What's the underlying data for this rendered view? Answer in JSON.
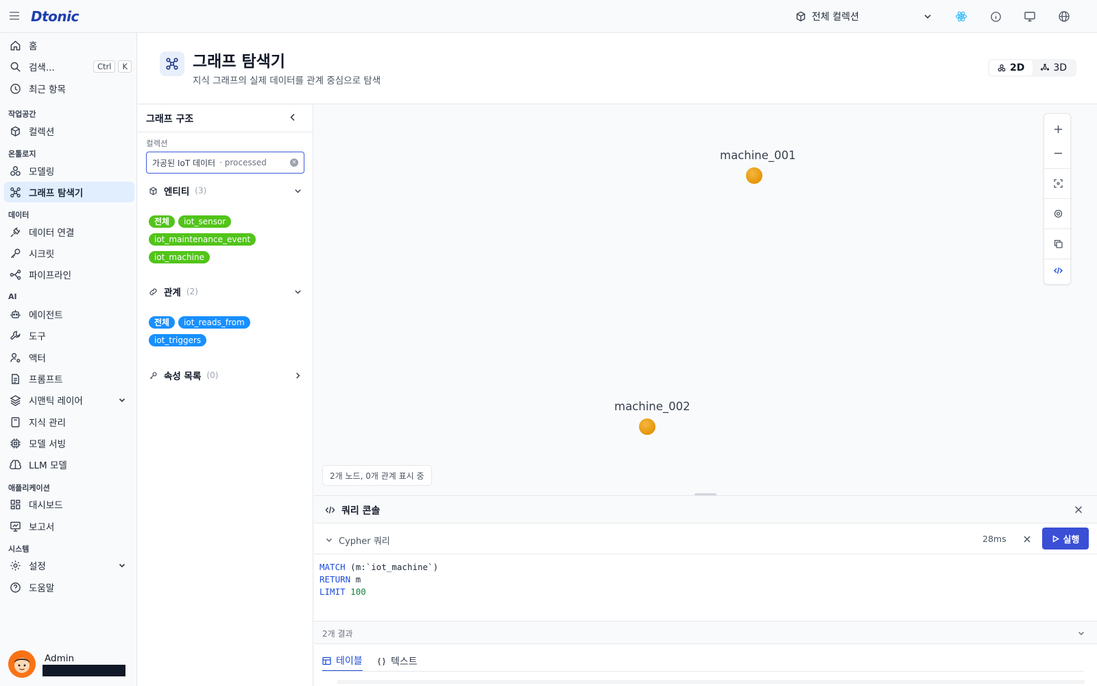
{
  "app": {
    "logo": "Dtonic"
  },
  "topbar": {
    "collection_label": "전체 컬렉션"
  },
  "sidebar": {
    "home": "홈",
    "search": "검색...",
    "search_kbd_1": "Ctrl",
    "search_kbd_2": "K",
    "recent": "최근 항목",
    "sec_workspace": "작업공간",
    "collection": "컬렉션",
    "sec_ontology": "온톨로지",
    "modeling": "모델링",
    "graph_explorer": "그래프 탐색기",
    "sec_data": "데이터",
    "data_connect": "데이터 연결",
    "secret": "시크릿",
    "pipeline": "파이프라인",
    "sec_ai": "AI",
    "agent": "에이전트",
    "tool": "도구",
    "actor": "액터",
    "prompt": "프롬프트",
    "semantic_layer": "시맨틱 레이어",
    "knowledge": "지식 관리",
    "model_serving": "모델 서빙",
    "llm_model": "LLM 모델",
    "sec_apps": "애플리케이션",
    "dashboard": "대시보드",
    "report": "보고서",
    "sec_system": "시스템",
    "settings": "설정",
    "help": "도움말",
    "user_name": "Admin"
  },
  "header": {
    "title": "그래프 탐색기",
    "subtitle": "지식 그래프의 실제 데이터를 관계 중심으로 탐색",
    "view_2d": "2D",
    "view_3d": "3D"
  },
  "panel": {
    "title": "그래프 구조",
    "collection_label": "컬렉션",
    "collection_value": "가공된 IoT 데이터",
    "collection_sub": "· processed",
    "entities_label": "엔티티",
    "entities_count": "(3)",
    "entity_tags": [
      "전체",
      "iot_sensor",
      "iot_maintenance_event",
      "iot_machine"
    ],
    "relations_label": "관계",
    "relations_count": "(2)",
    "relation_tags": [
      "전체",
      "iot_reads_from",
      "iot_triggers"
    ],
    "props_label": "속성 목록",
    "props_count": "(0)"
  },
  "graph": {
    "nodes": [
      {
        "label": "machine_001"
      },
      {
        "label": "machine_002"
      }
    ],
    "status": "2개 노드, 0개 관계 표시 중"
  },
  "console": {
    "title": "쿼리 콘솔",
    "query_label": "Cypher 쿼리",
    "elapsed": "28ms",
    "run_label": "실행",
    "code": {
      "l1_kw": "MATCH",
      "l1_rest": " (m:`iot_machine`)",
      "l2_kw": "RETURN",
      "l2_rest": " m",
      "l3_kw": "LIMIT",
      "l3_num": " 100"
    },
    "results_label": "2개 결과",
    "tab_table": "테이블",
    "tab_text": "텍스트"
  },
  "colors": {
    "accent": "#3b4fd6",
    "entity_tag": "#52c41a",
    "relation_tag": "#1890ff",
    "node": "#e69509"
  }
}
